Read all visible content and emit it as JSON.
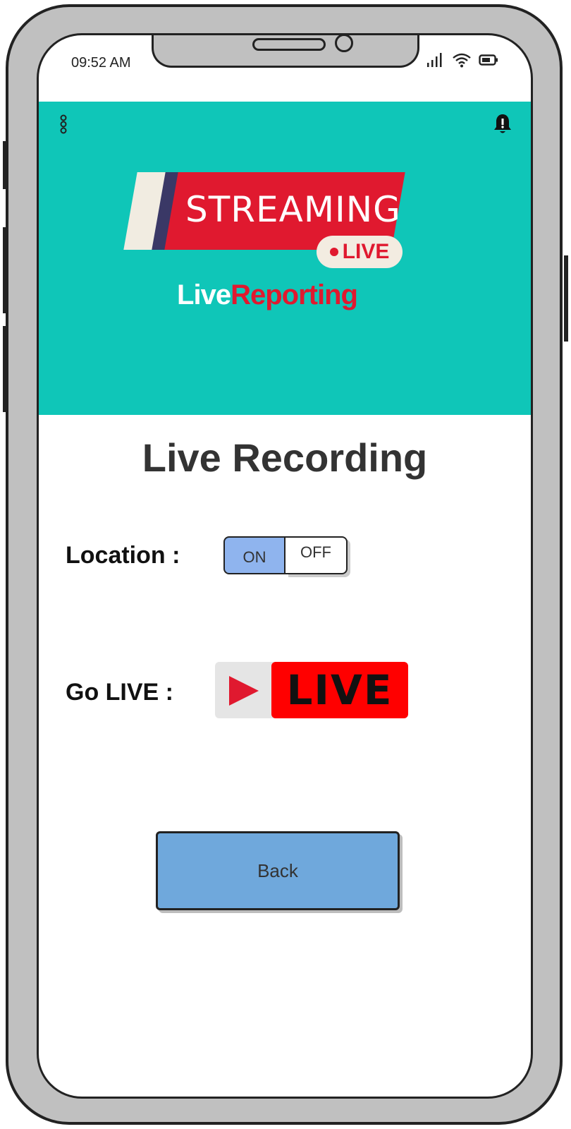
{
  "status_bar": {
    "time": "09:52 AM"
  },
  "header": {
    "background_color": "#0fc6b8",
    "logo": {
      "banner_text": "STREAMING",
      "pill_text": "LIVE",
      "caption_white": "Live",
      "caption_red": "Reporting"
    }
  },
  "main": {
    "title": "Live Recording",
    "location": {
      "label": "Location :",
      "toggle_on_label": "ON",
      "toggle_off_label": "OFF",
      "selected": "ON"
    },
    "go_live": {
      "label": "Go LIVE :",
      "button_text": "LIVE"
    },
    "back_button_label": "Back"
  },
  "colors": {
    "accent_teal": "#0fc6b8",
    "live_red": "#e0192f",
    "button_blue": "#6fa8dc",
    "toggle_on_blue": "#8fb4ee"
  }
}
